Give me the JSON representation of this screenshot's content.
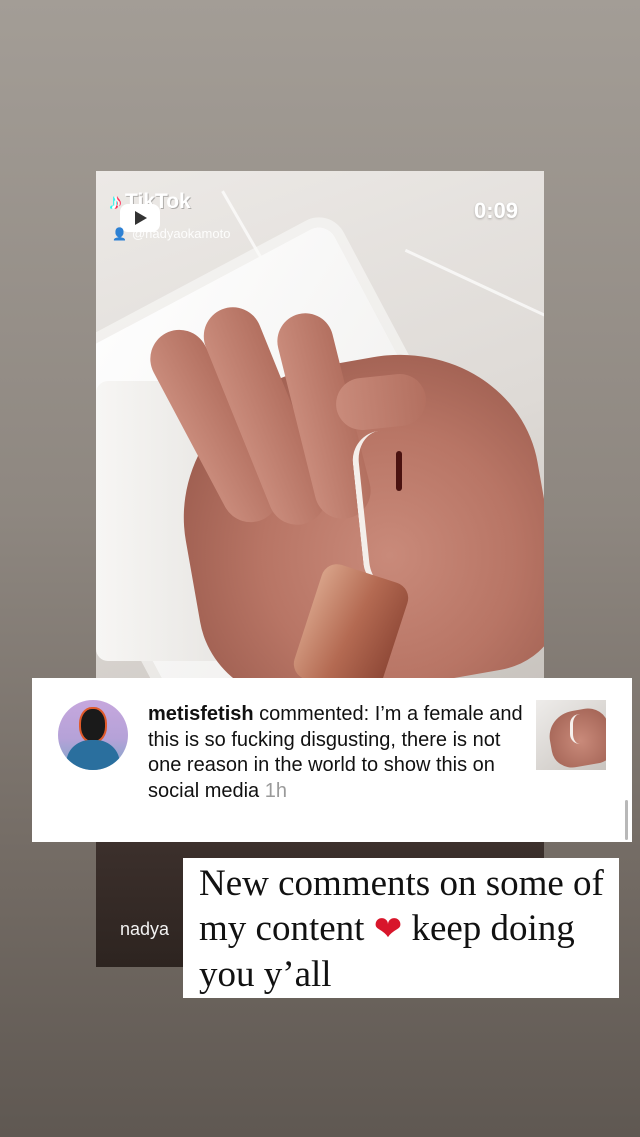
{
  "video": {
    "brand": "TikTok",
    "username": "@nadyaokamoto",
    "timer": "0:09",
    "bottom_username": "nadya"
  },
  "comment": {
    "username": "metisfetish",
    "action": "commented:",
    "text": "I’m a female and this is so fucking disgusting, there is not one reason in the world to show this on social media",
    "time": "1h"
  },
  "caption": {
    "line1": "New comments on some of my content",
    "line2": "keep doing you y’all"
  },
  "icons": [
    "tiktok-logo-icon",
    "play-icon",
    "user-icon",
    "heart-icon"
  ],
  "colors": {
    "heart": "#d8162b",
    "tiktok_cyan": "#25f4ee",
    "tiktok_red": "#fe2c55"
  }
}
